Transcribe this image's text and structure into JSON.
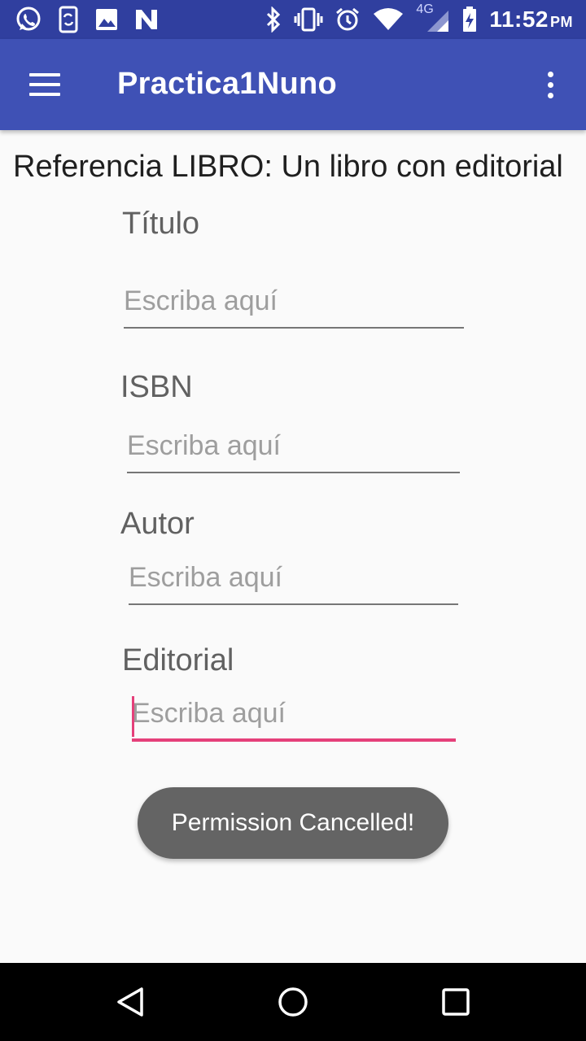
{
  "status_bar": {
    "time": "11:52",
    "ampm": "PM",
    "network": "4G",
    "notification_icons": [
      "whatsapp-icon",
      "phone-sync-icon",
      "gallery-icon",
      "n-app-icon"
    ],
    "system_icons": [
      "bluetooth-icon",
      "vibrate-icon",
      "alarm-icon",
      "wifi-icon",
      "signal-icon",
      "battery-charging-icon"
    ]
  },
  "app_bar": {
    "title": "Practica1Nuno",
    "background": "#3f51b5",
    "status_background": "#303f9f"
  },
  "main": {
    "heading": "Referencia LIBRO: Un libro con editorial",
    "fields": [
      {
        "label": "Título",
        "placeholder": "Escriba aquí",
        "value": ""
      },
      {
        "label": "ISBN",
        "placeholder": "Escriba aquí",
        "value": ""
      },
      {
        "label": "Autor",
        "placeholder": "Escriba aquí",
        "value": ""
      },
      {
        "label": "Editorial",
        "placeholder": "Escriba aquí",
        "value": "",
        "focused": true
      }
    ],
    "accent_color": "#e5407a"
  },
  "toast": {
    "message": "Permission Cancelled!"
  },
  "nav_bar": {
    "buttons": [
      "back-icon",
      "home-icon",
      "recents-icon"
    ]
  }
}
